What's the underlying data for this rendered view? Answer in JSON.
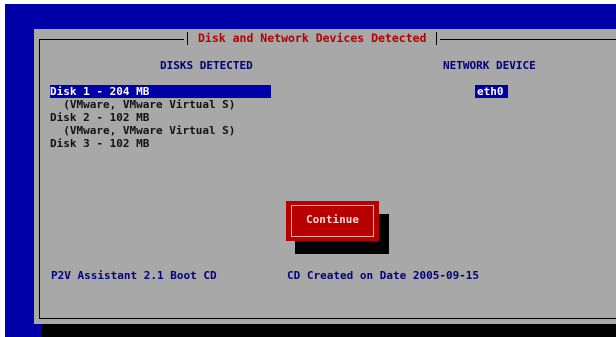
{
  "dialog": {
    "title": "Disk and Network Devices Detected",
    "disks_header": "DISKS DETECTED",
    "network_header": "NETWORK DEVICE",
    "disks": [
      "Disk 1 - 204 MB",
      "  (VMware, VMware Virtual S)",
      "Disk 2 - 102 MB",
      "  (VMware, VMware Virtual S)",
      "Disk 3 - 102 MB"
    ],
    "network_devices": [
      "eth0"
    ],
    "continue_label": "Continue",
    "footer_left": "P2V Assistant 2.1 Boot CD",
    "footer_right": "CD Created on Date 2005-09-15"
  },
  "colors": {
    "screen_bg": "#0000a8",
    "dialog_bg": "#a8a8a8",
    "title_text": "#b00000",
    "button_bg": "#b80000"
  }
}
